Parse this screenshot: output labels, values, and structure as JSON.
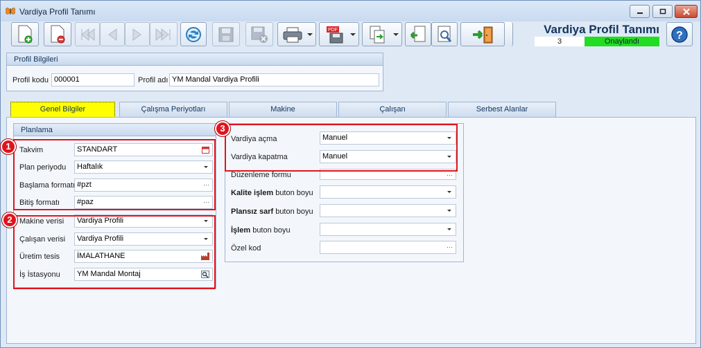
{
  "window": {
    "title": "Vardiya Profil Tanımı"
  },
  "header": {
    "title": "Vardiya Profil Tanımı",
    "doc_no": "3",
    "status": "Onaylandı",
    "status_color": "#22dd22"
  },
  "toolbar": {
    "buttons": [
      {
        "icon": "new-document-icon"
      },
      {
        "icon": "delete-document-icon"
      },
      {
        "icon": "first-record-icon"
      },
      {
        "icon": "previous-record-icon"
      },
      {
        "icon": "next-record-icon"
      },
      {
        "icon": "last-record-icon"
      },
      {
        "icon": "refresh-icon"
      },
      {
        "icon": "save-icon"
      },
      {
        "icon": "save-close-icon"
      },
      {
        "icon": "print-icon"
      },
      {
        "icon": "pdf-export-icon"
      },
      {
        "icon": "copy-icon"
      },
      {
        "icon": "import-icon"
      },
      {
        "icon": "settings-icon"
      },
      {
        "icon": "exit-icon"
      }
    ]
  },
  "profil": {
    "group_title": "Profil Bilgileri",
    "kod_label": "Profil kodu",
    "kod_value": "000001",
    "ad_label": "Profil adı",
    "ad_value": "YM Mandal Vardiya Profili"
  },
  "tabs": [
    "Genel Bilgiler",
    "Çalışma Periyotları",
    "Makine",
    "Çalışan",
    "Serbest Alanlar"
  ],
  "planlama": {
    "group_title": "Planlama",
    "takvim_label": "Takvim",
    "takvim_value": "STANDART",
    "plan_label": "Plan periyodu",
    "plan_value": "Haftalık",
    "baslama_label": "Başlama formatı",
    "baslama_value": "#pzt",
    "bitis_label": "Bitiş formatı",
    "bitis_value": "#paz",
    "makine_label": "Makine verisi",
    "makine_value": "Vardiya Profili",
    "calisan_label": "Çalışan verisi",
    "calisan_value": "Vardiya Profili",
    "uretim_label": "Üretim tesis",
    "uretim_value": "İMALATHANE",
    "istasyon_label": "İş İstasyonu",
    "istasyon_value": "YM Mandal Montaj"
  },
  "right": {
    "acma_label": "Vardiya açma",
    "acma_value": "Manuel",
    "kapatma_label": "Vardiya kapatma",
    "kapatma_value": "Manuel",
    "duzenleme_label": "Düzenleme formu",
    "kalite_bold": "Kalite işlem",
    "kalite_rest": " buton boyu",
    "plansiz_bold": "Plansız sarf",
    "plansiz_rest": " buton boyu",
    "islem_bold": "İşlem",
    "islem_rest": " buton boyu",
    "ozel_label": "Özel kod"
  },
  "badges": [
    "1",
    "2",
    "3"
  ],
  "colors": {
    "highlight": "#e0141e",
    "active_tab": "#ffff00"
  }
}
